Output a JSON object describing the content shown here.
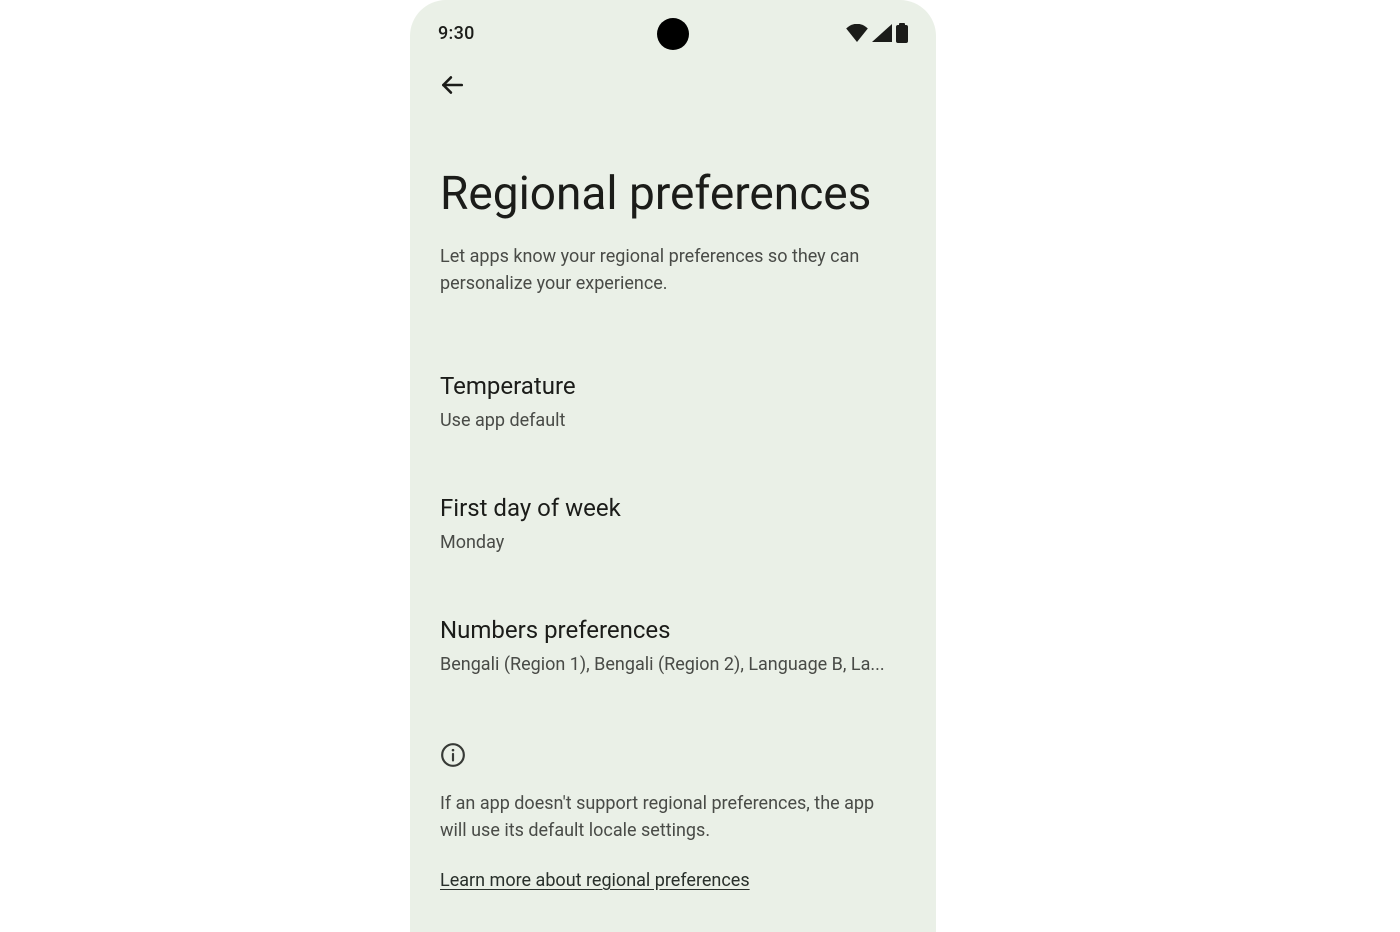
{
  "statusbar": {
    "time": "9:30"
  },
  "header": {
    "title": "Regional preferences",
    "subtitle": "Let apps know your regional preferences so they can personalize your experience."
  },
  "prefs": [
    {
      "title": "Temperature",
      "value": "Use app default"
    },
    {
      "title": "First day of week",
      "value": "Monday"
    },
    {
      "title": "Numbers preferences",
      "value": "Bengali (Region 1), Bengali (Region 2), Language B, La..."
    }
  ],
  "info": {
    "text": "If an app doesn't support regional preferences, the app will use its default locale settings.",
    "link": "Learn more about regional preferences"
  }
}
